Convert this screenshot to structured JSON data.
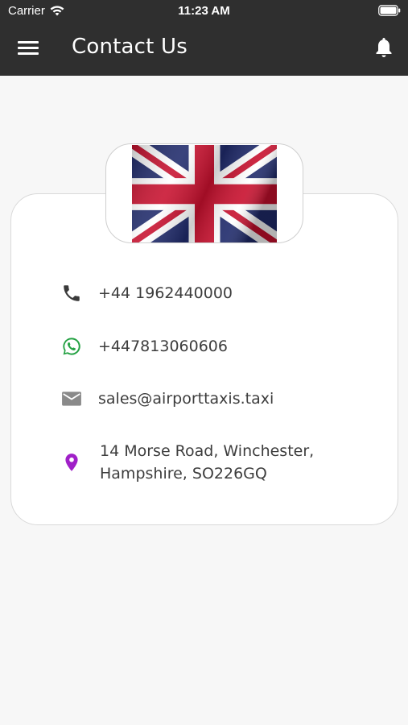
{
  "status_bar": {
    "carrier": "Carrier",
    "time": "11:23 AM"
  },
  "app_bar": {
    "title": "Contact Us"
  },
  "contact": {
    "phone": "+44 1962440000",
    "whatsapp": "+447813060606",
    "email": "sales@airporttaxis.taxi",
    "address_line1": "14 Morse Road, Winchester,",
    "address_line2": "Hampshire, SO226GQ"
  },
  "icons": {
    "phone": "phone-icon",
    "whatsapp": "whatsapp-icon",
    "email": "mail-icon",
    "address": "location-pin-icon",
    "flag": "union-jack-flag"
  },
  "colors": {
    "app_bar": "#2f2f2f",
    "background": "#f7f7f7",
    "whatsapp": "#25a244",
    "location": "#a020c8",
    "icon_dark": "#3a3a3a",
    "mail_grey": "#8a8a8a"
  }
}
